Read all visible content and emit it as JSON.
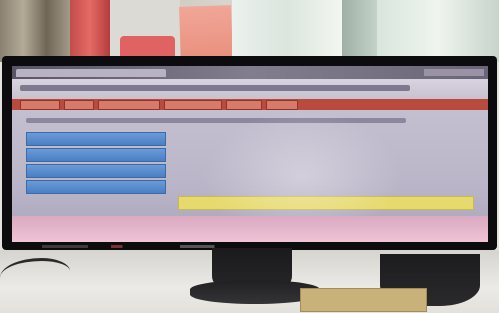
{
  "screen": {
    "window_title": "",
    "header_title": "",
    "nav": [
      {
        "label": ""
      },
      {
        "label": ""
      },
      {
        "label": ""
      },
      {
        "label": ""
      },
      {
        "label": ""
      },
      {
        "label": ""
      }
    ],
    "content_heading": "",
    "menu": [
      {
        "label": ""
      },
      {
        "label": ""
      },
      {
        "label": ""
      },
      {
        "label": ""
      }
    ],
    "notice": ""
  },
  "colors": {
    "nav_bar": "#b84a3e",
    "menu_button": "#4b7fc4",
    "notice_bar": "#e6d96e"
  }
}
